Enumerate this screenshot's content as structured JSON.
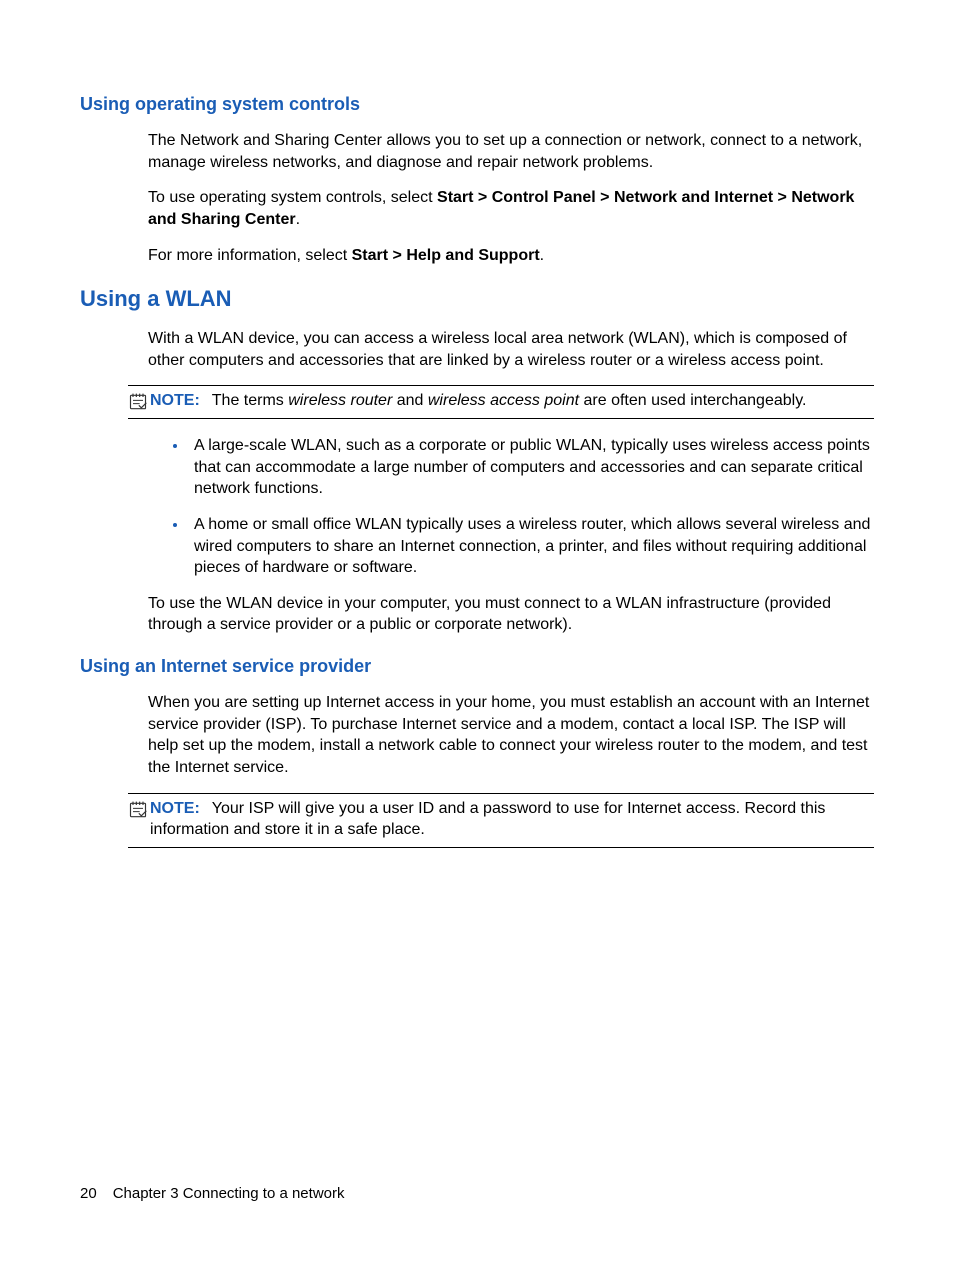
{
  "sections": {
    "os_controls": {
      "heading": "Using operating system controls",
      "p1": "The Network and Sharing Center allows you to set up a connection or network, connect to a network, manage wireless networks, and diagnose and repair network problems.",
      "p2_pre": "To use operating system controls, select ",
      "p2_bold": "Start > Control Panel > Network and Internet > Network and Sharing Center",
      "p2_post": ".",
      "p3_pre": "For more information, select ",
      "p3_bold": "Start > Help and Support",
      "p3_post": "."
    },
    "wlan": {
      "heading": "Using a WLAN",
      "p1": "With a WLAN device, you can access a wireless local area network (WLAN), which is composed of other computers and accessories that are linked by a wireless router or a wireless access point.",
      "note_label": "NOTE:",
      "note_pre": "The terms ",
      "note_i1": "wireless router",
      "note_mid": " and ",
      "note_i2": "wireless access point",
      "note_post": " are often used interchangeably.",
      "bullet1": "A large-scale WLAN, such as a corporate or public WLAN, typically uses wireless access points that can accommodate a large number of computers and accessories and can separate critical network functions.",
      "bullet2": "A home or small office WLAN typically uses a wireless router, which allows several wireless and wired computers to share an Internet connection, a printer, and files without requiring additional pieces of hardware or software.",
      "p2": "To use the WLAN device in your computer, you must connect to a WLAN infrastructure (provided through a service provider or a public or corporate network)."
    },
    "isp": {
      "heading": "Using an Internet service provider",
      "p1": "When you are setting up Internet access in your home, you must establish an account with an Internet service provider (ISP). To purchase Internet service and a modem, contact a local ISP. The ISP will help set up the modem, install a network cable to connect your wireless router to the modem, and test the Internet service.",
      "note_label": "NOTE:",
      "note_text": "Your ISP will give you a user ID and a password to use for Internet access. Record this information and store it in a safe place."
    }
  },
  "footer": {
    "page": "20",
    "chapter": "Chapter 3   Connecting to a network"
  }
}
